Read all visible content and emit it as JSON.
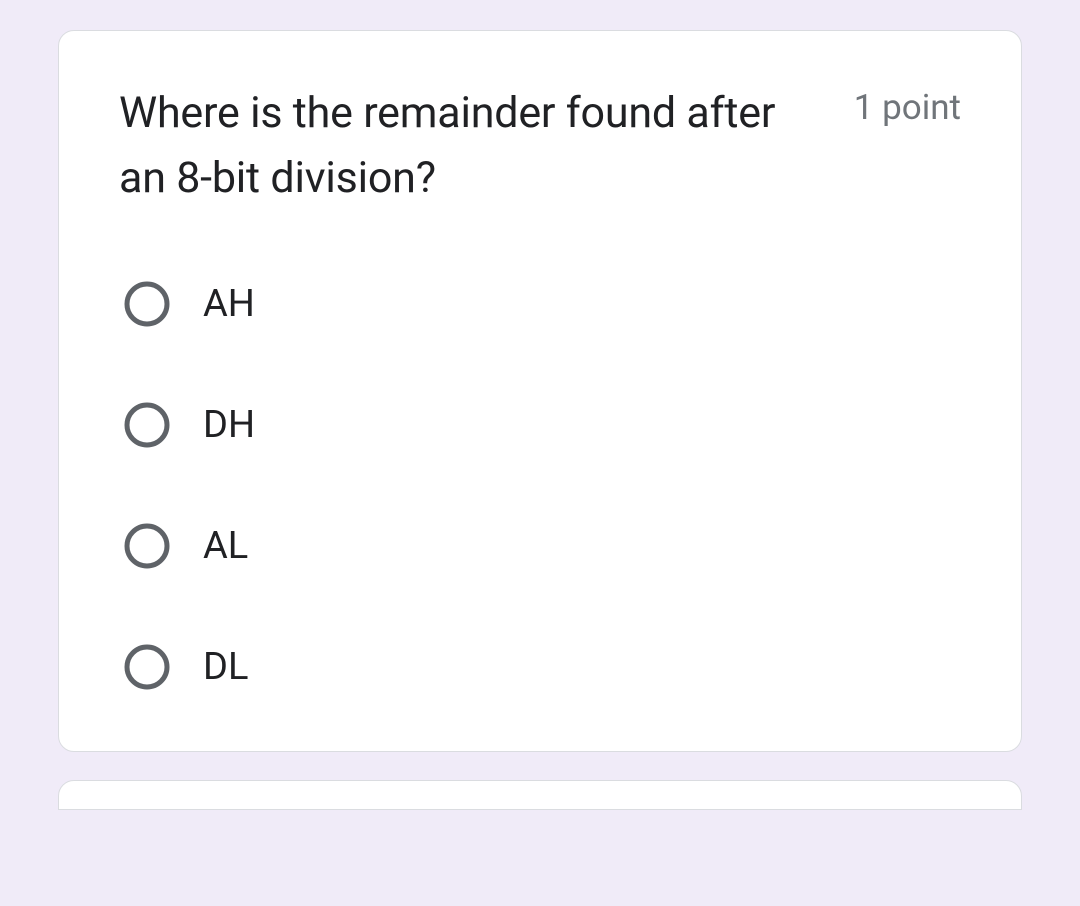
{
  "question": {
    "text": "Where is the remainder found after an 8-bit division?",
    "points": "1 point",
    "options": [
      {
        "label": "AH"
      },
      {
        "label": "DH"
      },
      {
        "label": "AL"
      },
      {
        "label": "DL"
      }
    ]
  }
}
